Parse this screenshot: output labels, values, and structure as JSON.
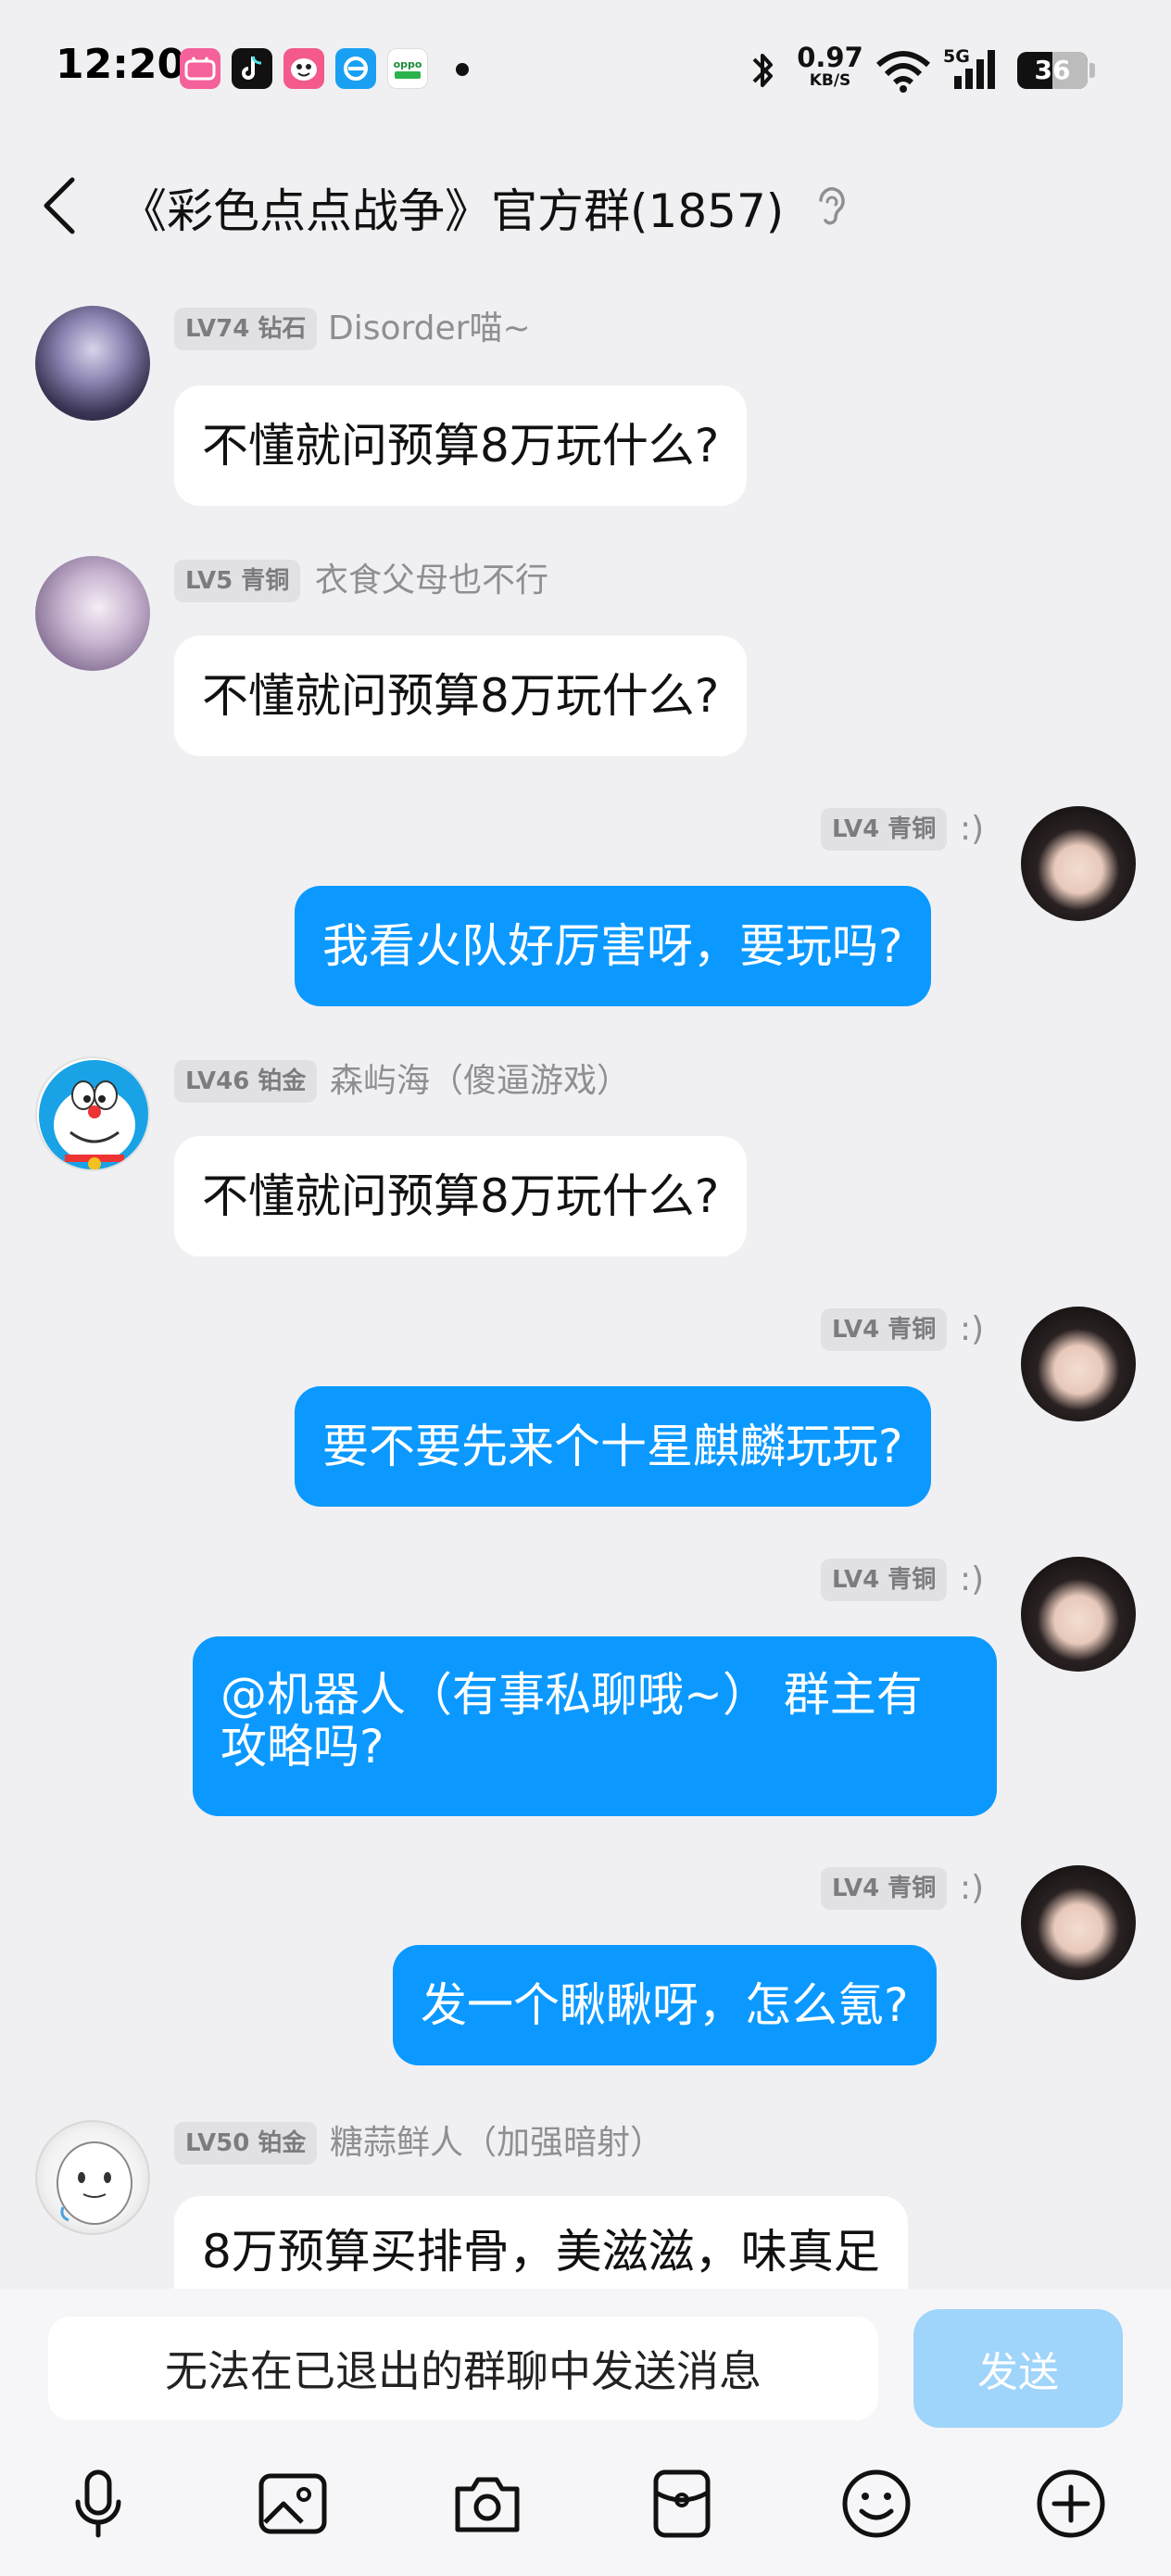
{
  "status_bar": {
    "time": "12:20",
    "app_icons": [
      "bilibili-icon",
      "tiktok-icon",
      "game-face-icon",
      "e-browser-icon",
      "oppo-app-icon"
    ],
    "net_speed_value": "0.97",
    "net_speed_unit": "KB/S",
    "network_type": "5G",
    "battery_level": "36"
  },
  "header": {
    "title": "《彩色点点战争》官方群(1857)"
  },
  "messages": [
    {
      "direction": "in",
      "level": "LV74 钻石",
      "sender": "Disorder喵~",
      "text": "不懂就问预算8万玩什么?"
    },
    {
      "direction": "in",
      "level": "LV5 青铜",
      "sender": "衣食父母也不行",
      "text": "不懂就问预算8万玩什么?"
    },
    {
      "direction": "out",
      "level": "LV4 青铜",
      "sender": ":)",
      "text": "我看火队好厉害呀，要玩吗?"
    },
    {
      "direction": "in",
      "level": "LV46 铂金",
      "sender": "森屿海（傻逼游戏）",
      "text": "不懂就问预算8万玩什么?"
    },
    {
      "direction": "out",
      "level": "LV4 青铜",
      "sender": ":)",
      "text": "要不要先来个十星麒麟玩玩?"
    },
    {
      "direction": "out",
      "level": "LV4 青铜",
      "sender": ":)",
      "text_line1": "@机器人（有事私聊哦~） 群主有",
      "text_line2": "攻略吗?"
    },
    {
      "direction": "out",
      "level": "LV4 青铜",
      "sender": ":)",
      "text": "发一个瞅瞅呀，怎么氪?"
    },
    {
      "direction": "in",
      "level": "LV50 铂金",
      "sender": "糖蒜鲜人（加强暗射）",
      "text": "8万预算买排骨，美滋滋，味真足"
    }
  ],
  "input": {
    "placeholder": "无法在已退出的群聊中发送消息",
    "send_label": "发送"
  },
  "toolbar_icons": [
    "microphone-icon",
    "image-icon",
    "camera-icon",
    "red-packet-icon",
    "emoji-icon",
    "plus-icon"
  ],
  "colors": {
    "accent": "#0b99ff",
    "send_disabled": "#9fd4fb",
    "background": "#f0f0f3"
  }
}
